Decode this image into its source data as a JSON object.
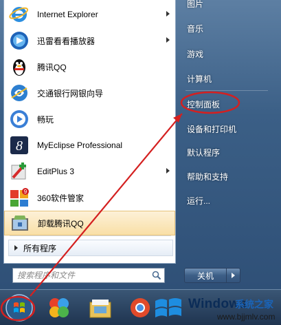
{
  "programs": [
    {
      "label": "Internet Explorer",
      "icon": "internet-explorer-icon",
      "has_submenu": true
    },
    {
      "label": "迅雷看看播放器",
      "icon": "xunlei-player-icon",
      "has_submenu": true
    },
    {
      "label": "腾讯QQ",
      "icon": "qq-penguin-icon",
      "has_submenu": false
    },
    {
      "label": "交通银行网银向导",
      "icon": "bank-guide-icon",
      "has_submenu": false
    },
    {
      "label": "畅玩",
      "icon": "changwan-icon",
      "has_submenu": false
    },
    {
      "label": "MyEclipse Professional",
      "icon": "myeclipse-icon",
      "has_submenu": false
    },
    {
      "label": "EditPlus 3",
      "icon": "editplus-icon",
      "has_submenu": true
    },
    {
      "label": "360软件管家",
      "icon": "360-software-manager-icon",
      "has_submenu": false
    },
    {
      "label": "卸载腾讯QQ",
      "icon": "uninstall-icon",
      "has_submenu": false
    }
  ],
  "all_programs_label": "所有程序",
  "search": {
    "placeholder": "搜索程序和文件"
  },
  "right_items": [
    "图片",
    "音乐",
    "游戏",
    "计算机",
    "控制面板",
    "设备和打印机",
    "默认程序",
    "帮助和支持",
    "运行..."
  ],
  "highlighted_right_item": "控制面板",
  "shutdown_label": "关机",
  "watermark": {
    "brand": "Windows",
    "sub": "系统之家",
    "url": "www.bjjmlv.com"
  },
  "colors": {
    "annotation_red": "#d42020",
    "highlight": "#f9dfa6"
  }
}
